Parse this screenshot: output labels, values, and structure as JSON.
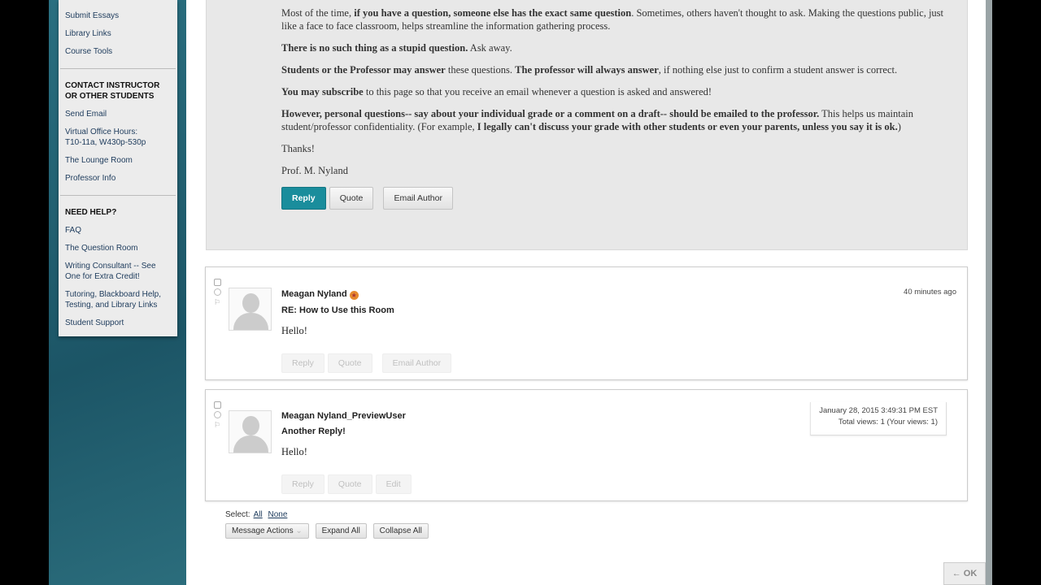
{
  "sidebar": {
    "items_top": [
      "Submit Essays",
      "Library Links",
      "Course Tools"
    ],
    "contact_heading": "CONTACT INSTRUCTOR OR OTHER STUDENTS",
    "contact_items": [
      "Send Email",
      "Virtual Office Hours: T10-11a, W430p-530p",
      "The Lounge Room",
      "Professor Info"
    ],
    "help_heading": "NEED HELP?",
    "help_items": [
      "FAQ",
      "The Question Room",
      "Writing Consultant -- See One for Extra Credit!",
      "Tutoring, Blackboard Help, Testing, and Library Links",
      "Student Support"
    ]
  },
  "original_post": {
    "p1a": "Most of the time, ",
    "p1b": "if you have a question, someone else has the exact same question",
    "p1c": ". Sometimes, others haven't thought to ask. Making the questions public, just like a face to face classroom, helps streamline the information gathering process.",
    "p2a": "There is no such thing as a stupid question.",
    "p2b": " Ask away.",
    "p3a": "Students or the Professor may answer",
    "p3b": " these questions. ",
    "p3c": "The professor will always answer",
    "p3d": ", if nothing else just to confirm a student answer is correct.",
    "p4a": "You may subscribe",
    "p4b": " to this page so that you receive an email whenever a question is asked and answered!",
    "p5a": "However, personal questions-- say about your individual grade or a comment on a draft-- should be emailed to the professor.",
    "p5b": " This helps us maintain student/professor confidentiality. (For example, ",
    "p5c": "I legally can't discuss your grade with other students or even your parents, unless you say it is ok.",
    "p5d": ")",
    "p6": "Thanks!",
    "p7": "Prof. M. Nyland",
    "buttons": {
      "reply": "Reply",
      "quote": "Quote",
      "email": "Email Author"
    }
  },
  "replies": [
    {
      "author": "Meagan Nyland",
      "subject": "RE: How to Use this Room",
      "body": "Hello!",
      "time": "40 minutes ago",
      "buttons": [
        "Reply",
        "Quote",
        "Email Author"
      ]
    },
    {
      "author": "Meagan Nyland_PreviewUser",
      "subject": "Another Reply!",
      "body": "Hello!",
      "date": "January 28, 2015 3:49:31 PM EST",
      "views": "Total views: 1 (Your views: 1)",
      "buttons": [
        "Reply",
        "Quote",
        "Edit"
      ]
    }
  ],
  "toolbar": {
    "select_label": "Select:",
    "all": "All",
    "none": "None",
    "message_actions": "Message Actions",
    "expand_all": "Expand All",
    "collapse_all": "Collapse All"
  },
  "ok_button": "← OK",
  "colors": {
    "accent": "#1a8d9c",
    "background_teal": "#1c5566"
  }
}
